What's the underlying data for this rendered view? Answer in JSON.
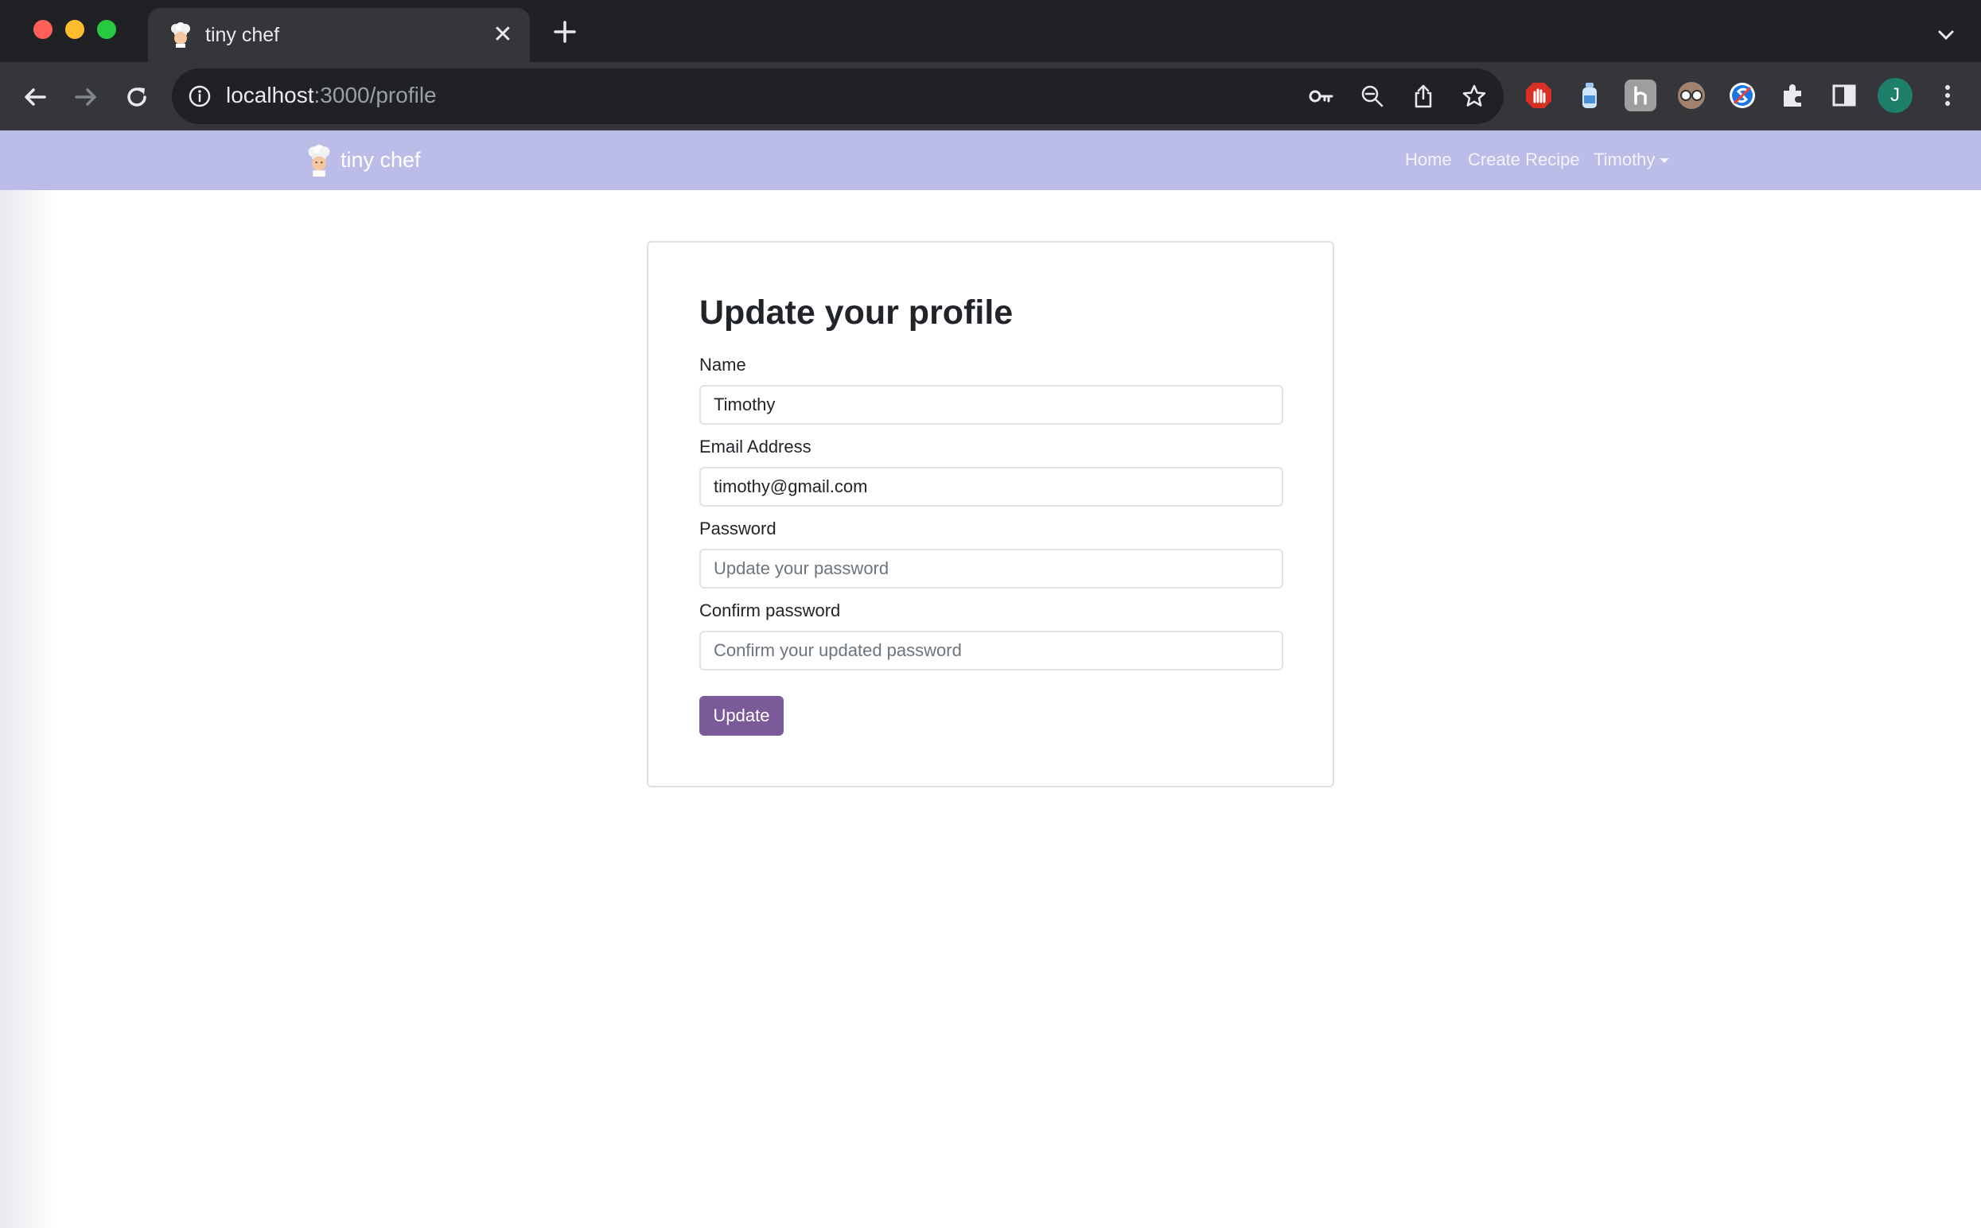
{
  "browser": {
    "tab": {
      "title": "tiny chef",
      "favicon": "chef-icon"
    },
    "address": {
      "host": "localhost",
      "path": ":3000/profile"
    },
    "toolbar_icons": [
      "back-icon",
      "forward-icon",
      "reload-icon",
      "info-icon",
      "key-icon",
      "zoom-out-icon",
      "share-icon",
      "star-icon",
      "adblock-extension-icon",
      "bottle-extension-icon",
      "h-extension-icon",
      "glasses-extension-icon",
      "s-extension-icon",
      "puzzle-icon",
      "sidepanel-icon",
      "kebab-menu-icon"
    ],
    "profile_initial": "J"
  },
  "site": {
    "brand": "tiny chef",
    "nav": {
      "home": "Home",
      "create_recipe": "Create Recipe",
      "user": "Timothy"
    },
    "colors": {
      "navbar": "#bbbde8",
      "button": "#7b5a99"
    }
  },
  "form": {
    "title": "Update your profile",
    "name": {
      "label": "Name",
      "value": "Timothy",
      "placeholder": ""
    },
    "email": {
      "label": "Email Address",
      "value": "timothy@gmail.com",
      "placeholder": ""
    },
    "password": {
      "label": "Password",
      "value": "",
      "placeholder": "Update your password"
    },
    "confirm": {
      "label": "Confirm password",
      "value": "",
      "placeholder": "Confirm your updated password"
    },
    "submit_label": "Update"
  }
}
